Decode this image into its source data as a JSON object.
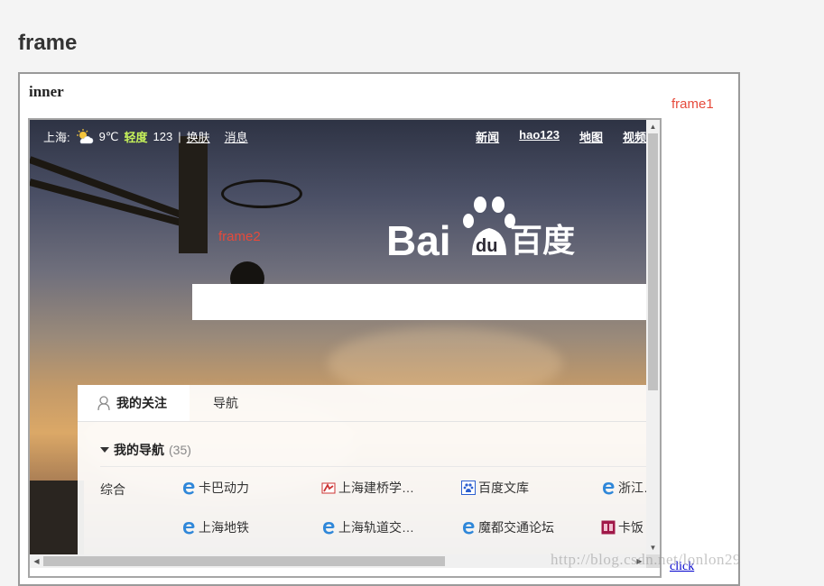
{
  "page": {
    "heading": "frame"
  },
  "outer_frame": {
    "inner_label": "inner",
    "frame1_label": "frame1",
    "click_link": "click"
  },
  "baidu": {
    "topbar": {
      "city": "上海:",
      "temperature": "9℃",
      "air_quality": "轻度",
      "aqi": "123",
      "separator": "|",
      "skin_link": "换肤",
      "message_link": "消息",
      "nav": [
        "新闻",
        "hao123",
        "地图",
        "视频"
      ]
    },
    "frame2_label": "frame2",
    "logo": {
      "bai": "Bai",
      "du": "du",
      "cn": "百度"
    },
    "search": {
      "value": "",
      "placeholder": ""
    },
    "panel": {
      "tabs": [
        {
          "label": "我的关注",
          "active": true
        },
        {
          "label": "导航",
          "active": false
        }
      ],
      "section_title": "我的导航",
      "section_count": "(35)",
      "category": "综合",
      "sites": [
        [
          "卡巴动力",
          "上海建桥学…",
          "百度文库",
          "浙江…"
        ],
        [
          "上海地铁",
          "上海轨道交…",
          "魔都交通论坛",
          "卡饭"
        ]
      ]
    }
  },
  "watermark": "http://blog.csdn.net/lonlon29",
  "colors": {
    "accent_red": "#e64a3b",
    "aq_green": "#c6f25a",
    "link_blue": "#0000cc"
  }
}
